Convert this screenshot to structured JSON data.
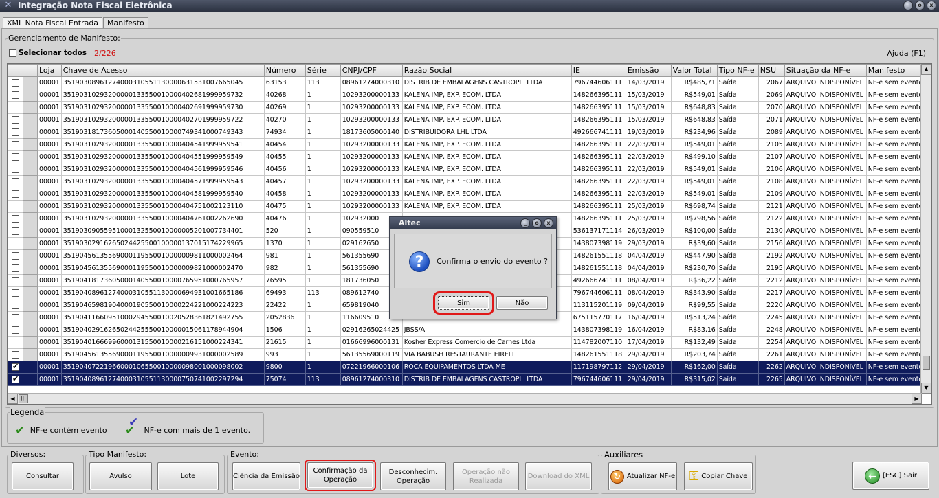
{
  "window": {
    "title": "Integração Nota Fiscal Eletrônica",
    "buttons": [
      "_",
      "o",
      "x"
    ]
  },
  "tabs": [
    {
      "label": "XML Nota Fiscal Entrada",
      "active": true
    },
    {
      "label": "Manifesto",
      "active": false
    }
  ],
  "manifesto": {
    "group_title": "Gerenciamento de Manifesto:",
    "select_all_label": "Selecionar todos",
    "selected_count": "2/226",
    "help_label": "Ajuda (F1)"
  },
  "grid": {
    "columns": [
      "",
      "",
      "Loja",
      "Chave de Acesso",
      "Número",
      "Série",
      "CNPJ/CPF",
      "Razão Social",
      "IE",
      "Emissão",
      "Valor Total",
      "Tipo NF-e",
      "NSU",
      "Situação da NF-e",
      "Manifesto"
    ],
    "rows": [
      {
        "checked": false,
        "loja": "00001",
        "chave": "35190308961274000310551130000631531007665045",
        "numero": "63153",
        "serie": "113",
        "cnpj": "08961274000310",
        "razao": "DISTRIB DE EMBALAGENS CASTROPIL LTDA",
        "ie": "796744606111",
        "emissao": "14/03/2019",
        "valor": "R$485,71",
        "tipo": "Saída",
        "nsu": "2067",
        "situacao": "ARQUIVO INDISPONÍVEL",
        "manifesto": "NF-e sem evento"
      },
      {
        "checked": false,
        "loja": "00001",
        "chave": "35190310293200000133550010000402681999959732",
        "numero": "40268",
        "serie": "1",
        "cnpj": "10293200000133",
        "razao": "KALENA IMP, EXP. ECOM. LTDA",
        "ie": "148266395111",
        "emissao": "15/03/2019",
        "valor": "R$549,01",
        "tipo": "Saída",
        "nsu": "2069",
        "situacao": "ARQUIVO INDISPONÍVEL",
        "manifesto": "NF-e sem evento"
      },
      {
        "checked": false,
        "loja": "00001",
        "chave": "35190310293200000133550010000402691999959730",
        "numero": "40269",
        "serie": "1",
        "cnpj": "10293200000133",
        "razao": "KALENA IMP, EXP. ECOM. LTDA",
        "ie": "148266395111",
        "emissao": "15/03/2019",
        "valor": "R$648,83",
        "tipo": "Saída",
        "nsu": "2070",
        "situacao": "ARQUIVO INDISPONÍVEL",
        "manifesto": "NF-e sem evento"
      },
      {
        "checked": false,
        "loja": "00001",
        "chave": "35190310293200000133550010000402701999959722",
        "numero": "40270",
        "serie": "1",
        "cnpj": "10293200000133",
        "razao": "KALENA IMP, EXP. ECOM. LTDA",
        "ie": "148266395111",
        "emissao": "15/03/2019",
        "valor": "R$648,83",
        "tipo": "Saída",
        "nsu": "2071",
        "situacao": "ARQUIVO INDISPONÍVEL",
        "manifesto": "NF-e sem evento"
      },
      {
        "checked": false,
        "loja": "00001",
        "chave": "35190318173605000140550010000749341000749343",
        "numero": "74934",
        "serie": "1",
        "cnpj": "18173605000140",
        "razao": "DISTRIBUIDORA LHL LTDA",
        "ie": "492666741111",
        "emissao": "19/03/2019",
        "valor": "R$234,96",
        "tipo": "Saída",
        "nsu": "2089",
        "situacao": "ARQUIVO INDISPONÍVEL",
        "manifesto": "NF-e sem evento"
      },
      {
        "checked": false,
        "loja": "00001",
        "chave": "35190310293200000133550010000404541999959541",
        "numero": "40454",
        "serie": "1",
        "cnpj": "10293200000133",
        "razao": "KALENA IMP, EXP. ECOM. LTDA",
        "ie": "148266395111",
        "emissao": "22/03/2019",
        "valor": "R$549,01",
        "tipo": "Saída",
        "nsu": "2105",
        "situacao": "ARQUIVO INDISPONÍVEL",
        "manifesto": "NF-e sem evento"
      },
      {
        "checked": false,
        "loja": "00001",
        "chave": "35190310293200000133550010000404551999959549",
        "numero": "40455",
        "serie": "1",
        "cnpj": "10293200000133",
        "razao": "KALENA IMP, EXP. ECOM. LTDA",
        "ie": "148266395111",
        "emissao": "22/03/2019",
        "valor": "R$499,10",
        "tipo": "Saída",
        "nsu": "2107",
        "situacao": "ARQUIVO INDISPONÍVEL",
        "manifesto": "NF-e sem evento"
      },
      {
        "checked": false,
        "loja": "00001",
        "chave": "35190310293200000133550010000404561999959546",
        "numero": "40456",
        "serie": "1",
        "cnpj": "10293200000133",
        "razao": "KALENA IMP, EXP. ECOM. LTDA",
        "ie": "148266395111",
        "emissao": "22/03/2019",
        "valor": "R$549,01",
        "tipo": "Saída",
        "nsu": "2106",
        "situacao": "ARQUIVO INDISPONÍVEL",
        "manifesto": "NF-e sem evento"
      },
      {
        "checked": false,
        "loja": "00001",
        "chave": "35190310293200000133550010000404571999959543",
        "numero": "40457",
        "serie": "1",
        "cnpj": "10293200000133",
        "razao": "KALENA IMP, EXP. ECOM. LTDA",
        "ie": "148266395111",
        "emissao": "22/03/2019",
        "valor": "R$549,01",
        "tipo": "Saída",
        "nsu": "2108",
        "situacao": "ARQUIVO INDISPONÍVEL",
        "manifesto": "NF-e sem evento"
      },
      {
        "checked": false,
        "loja": "00001",
        "chave": "35190310293200000133550010000404581999959540",
        "numero": "40458",
        "serie": "1",
        "cnpj": "10293200000133",
        "razao": "KALENA IMP, EXP. ECOM. LTDA",
        "ie": "148266395111",
        "emissao": "22/03/2019",
        "valor": "R$549,01",
        "tipo": "Saída",
        "nsu": "2109",
        "situacao": "ARQUIVO INDISPONÍVEL",
        "manifesto": "NF-e sem evento"
      },
      {
        "checked": false,
        "loja": "00001",
        "chave": "35190310293200000133550010000404751002123110",
        "numero": "40475",
        "serie": "1",
        "cnpj": "10293200000133",
        "razao": "KALENA IMP, EXP. ECOM. LTDA",
        "ie": "148266395111",
        "emissao": "25/03/2019",
        "valor": "R$698,74",
        "tipo": "Saída",
        "nsu": "2121",
        "situacao": "ARQUIVO INDISPONÍVEL",
        "manifesto": "NF-e sem evento"
      },
      {
        "checked": false,
        "loja": "00001",
        "chave": "35190310293200000133550010000404761002262690",
        "numero": "40476",
        "serie": "1",
        "cnpj": "102932000",
        "razao": "",
        "ie": "148266395111",
        "emissao": "25/03/2019",
        "valor": "R$798,56",
        "tipo": "Saída",
        "nsu": "2122",
        "situacao": "ARQUIVO INDISPONÍVEL",
        "manifesto": "NF-e sem evento"
      },
      {
        "checked": false,
        "loja": "00001",
        "chave": "35190309055951000132550010000005201007734401",
        "numero": "520",
        "serie": "1",
        "cnpj": "090559510",
        "razao": "",
        "ie": "536137171114",
        "emissao": "26/03/2019",
        "valor": "R$100,00",
        "tipo": "Saída",
        "nsu": "2130",
        "situacao": "ARQUIVO INDISPONÍVEL",
        "manifesto": "NF-e sem evento"
      },
      {
        "checked": false,
        "loja": "00001",
        "chave": "35190302916265024425500100000137015174229965",
        "numero": "1370",
        "serie": "1",
        "cnpj": "029162650",
        "razao": "",
        "ie": "143807398119",
        "emissao": "29/03/2019",
        "valor": "R$39,60",
        "tipo": "Saída",
        "nsu": "2156",
        "situacao": "ARQUIVO INDISPONÍVEL",
        "manifesto": "NF-e sem evento"
      },
      {
        "checked": false,
        "loja": "00001",
        "chave": "35190456135569000119550010000009811000002464",
        "numero": "981",
        "serie": "1",
        "cnpj": "561355690",
        "razao": "",
        "ie": "148261551118",
        "emissao": "04/04/2019",
        "valor": "R$447,90",
        "tipo": "Saída",
        "nsu": "2192",
        "situacao": "ARQUIVO INDISPONÍVEL",
        "manifesto": "NF-e sem evento"
      },
      {
        "checked": false,
        "loja": "00001",
        "chave": "35190456135569000119550010000009821000002470",
        "numero": "982",
        "serie": "1",
        "cnpj": "561355690",
        "razao": "",
        "ie": "148261551118",
        "emissao": "04/04/2019",
        "valor": "R$230,70",
        "tipo": "Saída",
        "nsu": "2195",
        "situacao": "ARQUIVO INDISPONÍVEL",
        "manifesto": "NF-e sem evento"
      },
      {
        "checked": false,
        "loja": "00001",
        "chave": "35190418173605000140550010000765951000765957",
        "numero": "76595",
        "serie": "1",
        "cnpj": "181736050",
        "razao": "",
        "ie": "492666741111",
        "emissao": "08/04/2019",
        "valor": "R$36,22",
        "tipo": "Saída",
        "nsu": "2212",
        "situacao": "ARQUIVO INDISPONÍVEL",
        "manifesto": "NF-e sem evento"
      },
      {
        "checked": false,
        "loja": "00001",
        "chave": "35190408961274000310551130000694931001665186",
        "numero": "69493",
        "serie": "113",
        "cnpj": "089612740",
        "razao": "",
        "ie": "796744606111",
        "emissao": "08/04/2019",
        "valor": "R$343,90",
        "tipo": "Saída",
        "nsu": "2217",
        "situacao": "ARQUIVO INDISPONÍVEL",
        "manifesto": "NF-e sem evento"
      },
      {
        "checked": false,
        "loja": "00001",
        "chave": "35190465981904000190550010000224221000224223",
        "numero": "22422",
        "serie": "1",
        "cnpj": "659819040",
        "razao": "",
        "ie": "113115201119",
        "emissao": "09/04/2019",
        "valor": "R$99,55",
        "tipo": "Saída",
        "nsu": "2220",
        "situacao": "ARQUIVO INDISPONÍVEL",
        "manifesto": "NF-e sem evento"
      },
      {
        "checked": false,
        "loja": "00001",
        "chave": "35190411660951000294550010020528361821492755",
        "numero": "2052836",
        "serie": "1",
        "cnpj": "116609510",
        "razao": "",
        "ie": "675115770117",
        "emissao": "16/04/2019",
        "valor": "R$513,24",
        "tipo": "Saída",
        "nsu": "2245",
        "situacao": "ARQUIVO INDISPONÍVEL",
        "manifesto": "NF-e sem evento"
      },
      {
        "checked": false,
        "loja": "00001",
        "chave": "35190402916265024425550010000015061178944904",
        "numero": "1506",
        "serie": "1",
        "cnpj": "02916265024425",
        "razao": "JBSS/A",
        "ie": "143807398119",
        "emissao": "16/04/2019",
        "valor": "R$83,16",
        "tipo": "Saída",
        "nsu": "2248",
        "situacao": "ARQUIVO INDISPONÍVEL",
        "manifesto": "NF-e sem evento"
      },
      {
        "checked": false,
        "loja": "00001",
        "chave": "35190401666996000131550010000216151000224341",
        "numero": "21615",
        "serie": "1",
        "cnpj": "01666996000131",
        "razao": "Kosher Express Comercio de Carnes Ltda",
        "ie": "114782007110",
        "emissao": "17/04/2019",
        "valor": "R$132,49",
        "tipo": "Saída",
        "nsu": "2254",
        "situacao": "ARQUIVO INDISPONÍVEL",
        "manifesto": "NF-e sem evento"
      },
      {
        "checked": false,
        "loja": "00001",
        "chave": "35190456135569000119550010000009931000002589",
        "numero": "993",
        "serie": "1",
        "cnpj": "56135569000119",
        "razao": "VIA BABUSH RESTAURANTE EIRELI",
        "ie": "148261551118",
        "emissao": "29/04/2019",
        "valor": "R$203,74",
        "tipo": "Saída",
        "nsu": "2261",
        "situacao": "ARQUIVO INDISPONÍVEL",
        "manifesto": "NF-e sem evento"
      },
      {
        "checked": true,
        "loja": "00001",
        "chave": "35190407221966000106550010000098001000098002",
        "numero": "9800",
        "serie": "1",
        "cnpj": "07221966000106",
        "razao": "ROCA EQUIPAMENTOS LTDA ME",
        "ie": "117198797112",
        "emissao": "29/04/2019",
        "valor": "R$162,00",
        "tipo": "Saída",
        "nsu": "2262",
        "situacao": "ARQUIVO INDISPONÍVEL",
        "manifesto": "NF-e sem evento"
      },
      {
        "checked": true,
        "loja": "00001",
        "chave": "35190408961274000310551130000750741002297294",
        "numero": "75074",
        "serie": "113",
        "cnpj": "08961274000310",
        "razao": "DISTRIB DE EMBALAGENS CASTROPIL LTDA",
        "ie": "796744606111",
        "emissao": "29/04/2019",
        "valor": "R$315,02",
        "tipo": "Saída",
        "nsu": "2265",
        "situacao": "ARQUIVO INDISPONÍVEL",
        "manifesto": "NF-e sem evento"
      }
    ]
  },
  "legenda": {
    "title": "Legenda",
    "item1": "NF-e contém evento",
    "item2": "NF-e com mais de 1 evento.",
    "colors": {
      "single": "#2a8a1a",
      "multi_a": "#2a8a1a",
      "multi_b": "#3a3ab8"
    }
  },
  "toolbar": {
    "diversos_title": "Diversos:",
    "consultar": "Consultar",
    "tipo_title": "Tipo Manifesto:",
    "avulso": "Avulso",
    "lote": "Lote",
    "evento_title": "Evento:",
    "ciencia": "Ciência da Emissão",
    "confirmacao": "Confirmação da Operação",
    "desconhecimento": "Desconhecim. Operação",
    "nao_realizada": "Operação não Realizada",
    "download": "Download do XML",
    "auxiliares_title": "Auxiliares",
    "atualizar": "Atualizar NF-e",
    "copiar": "Copiar Chave",
    "sair": "[ESC] Sair"
  },
  "dialog": {
    "title": "Altec",
    "message": "Confirma o envio do evento ?",
    "yes": "Sim",
    "no": "Não"
  },
  "colors": {
    "selected_row": "#0f1b5c",
    "highlight": "#e01818",
    "count_text": "#d01010"
  }
}
